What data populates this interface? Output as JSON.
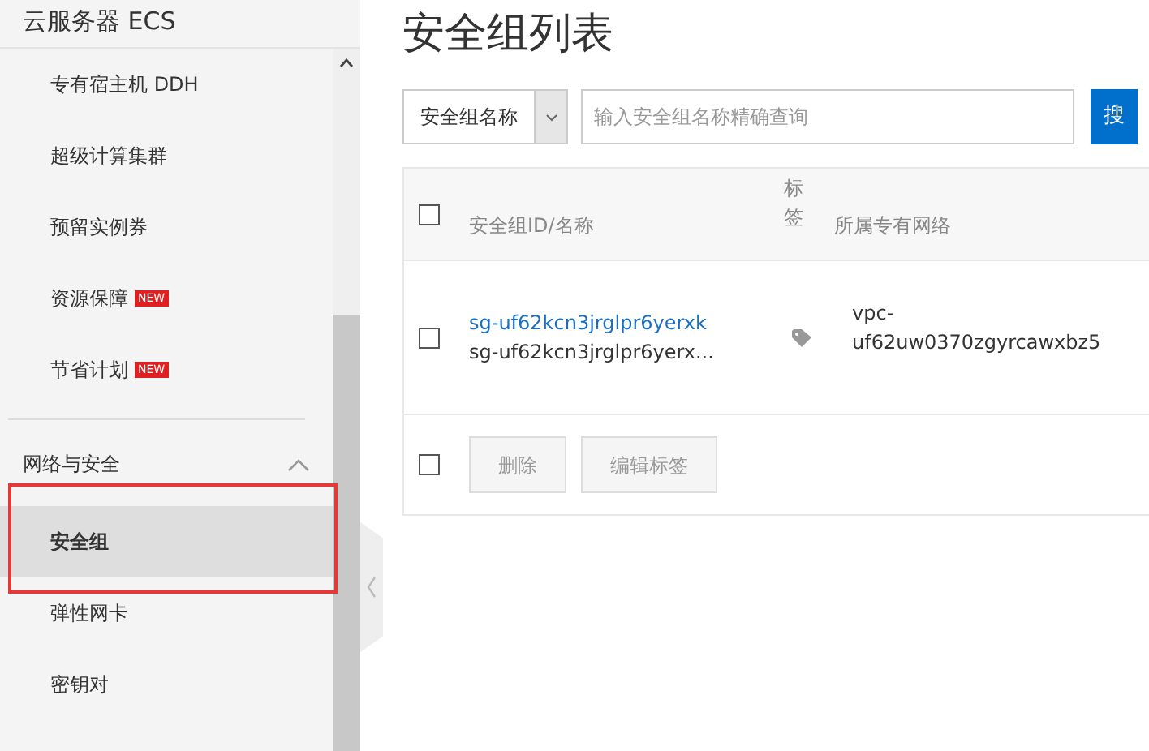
{
  "sidebar": {
    "title": "云服务器 ECS",
    "items": [
      {
        "label": "专有宿主机 DDH",
        "selected": false
      },
      {
        "label": "超级计算集群",
        "selected": false
      },
      {
        "label": "预留实例券",
        "selected": false
      },
      {
        "label": "资源保障",
        "badge": "NEW",
        "selected": false
      },
      {
        "label": "节省计划",
        "badge": "NEW",
        "selected": false
      }
    ],
    "section": {
      "label": "网络与安全",
      "expanded": true,
      "items": [
        {
          "label": "安全组",
          "selected": true
        },
        {
          "label": "弹性网卡",
          "selected": false
        },
        {
          "label": "密钥对",
          "selected": false
        }
      ]
    }
  },
  "page_title": "安全组列表",
  "search": {
    "filter": "安全组名称",
    "placeholder": "输入安全组名称精确查询",
    "button": "搜"
  },
  "table": {
    "all_checked": false,
    "columns": [
      "安全组ID/名称",
      "标签",
      "所属专有网络"
    ],
    "rows": [
      {
        "checked": false,
        "id": "sg-uf62kcn3jrglpr6yerxk",
        "name": "sg-uf62kcn3jrglpr6yerx...",
        "vpc": "vpc-uf62uw0370zgyrcawxbz5"
      }
    ],
    "footer": {
      "checked": false,
      "buttons": [
        {
          "label": "删除",
          "disabled": true
        },
        {
          "label": "编辑标签",
          "disabled": true
        }
      ]
    }
  }
}
